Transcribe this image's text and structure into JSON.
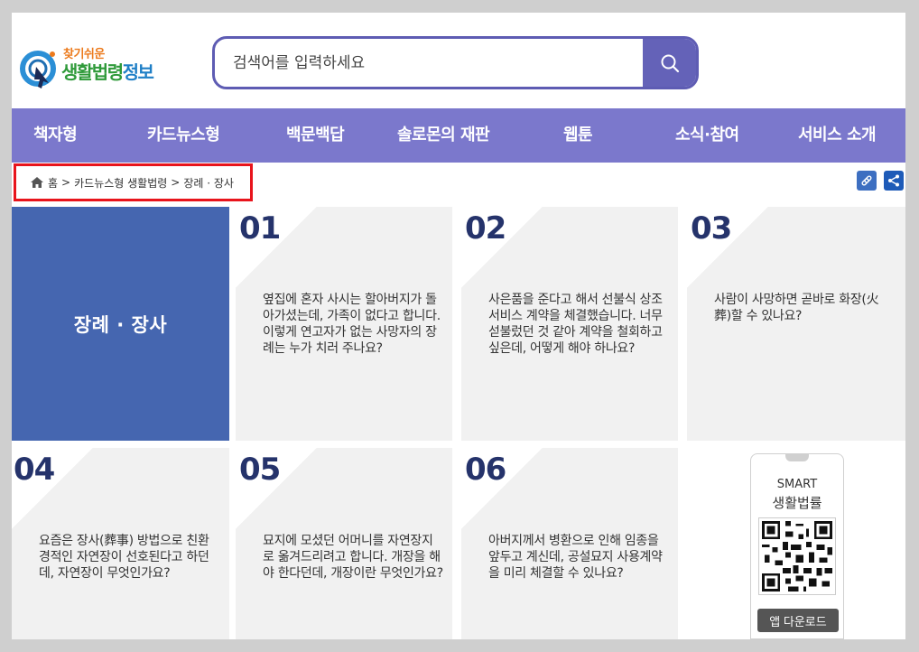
{
  "logo": {
    "line1": "찾기쉬운",
    "line2a": "생활법령",
    "line2b": "정보"
  },
  "search": {
    "placeholder": "검색어를 입력하세요",
    "value": ""
  },
  "nav": {
    "items": [
      {
        "label": "책자형"
      },
      {
        "label": "카드뉴스형"
      },
      {
        "label": "백문백답"
      },
      {
        "label": "솔로몬의 재판"
      },
      {
        "label": "웹툰"
      },
      {
        "label": "소식·참여"
      },
      {
        "label": "서비스 소개"
      }
    ]
  },
  "breadcrumb": {
    "home": "홈",
    "sep": ">",
    "level1": "카드뉴스형 생활법령",
    "level2": "장례 · 장사"
  },
  "category_title": "장례 · 장사",
  "tiles": [
    {
      "num": "01",
      "question": "옆집에 혼자 사시는 할아버지가 돌아가셨는데, 가족이 없다고 합니다. 이렇게 연고자가 없는 사망자의 장례는 누가 치러 주나요?"
    },
    {
      "num": "02",
      "question": "사은품을 준다고 해서 선불식 상조서비스 계약을 체결했습니다. 너무 섣불렀던 것 같아 계약을 철회하고 싶은데, 어떻게 해야 하나요?"
    },
    {
      "num": "03",
      "question": "사람이 사망하면 곧바로 화장(火葬)할 수 있나요?"
    },
    {
      "num": "04",
      "question": "요즘은 장사(葬事) 방법으로 친환경적인 자연장이 선호된다고 하던데, 자연장이 무엇인가요?"
    },
    {
      "num": "05",
      "question": "묘지에 모셨던 어머니를 자연장지로 옮겨드리려고 합니다. 개장을 해야 한다던데, 개장이란 무엇인가요?"
    },
    {
      "num": "06",
      "question": "아버지께서 병환으로 인해 임종을 앞두고 계신데, 공설묘지 사용계약을 미리 체결할 수 있나요?"
    }
  ],
  "app": {
    "smart": "SMART",
    "name": "생활법률",
    "download": "앱 다운로드"
  },
  "colors": {
    "nav": "#7b78cc",
    "search_border": "#5e5cb3",
    "category": "#4566b0",
    "number": "#25336b",
    "highlight": "#e8141c",
    "util": "#3d6fc1"
  }
}
